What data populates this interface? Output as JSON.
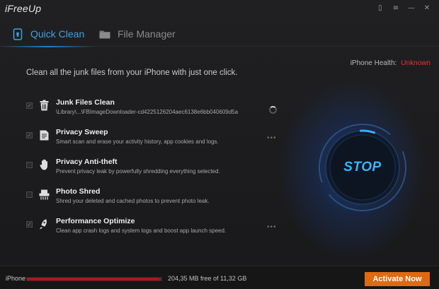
{
  "app": {
    "title": "iFreeUp"
  },
  "window_controls": [
    {
      "icon": "phone-icon",
      "glyph": "▯"
    },
    {
      "icon": "menu-icon",
      "glyph": "≡"
    },
    {
      "icon": "minimize-icon",
      "glyph": "—"
    },
    {
      "icon": "close-icon",
      "glyph": "✕"
    }
  ],
  "tabs": [
    {
      "label": "Quick Clean",
      "icon": "phone-clean-icon",
      "active": true
    },
    {
      "label": "File Manager",
      "icon": "folder-icon",
      "active": false
    }
  ],
  "health": {
    "label": "iPhone Health:",
    "value": "Unknown",
    "value_color": "#e3342f"
  },
  "intro": "Clean all the junk files from your iPhone with just one click.",
  "tasks": [
    {
      "title": "Junk Files Clean",
      "desc": "\\Library\\...\\FBImageDownloader-cd4225126204aec6138e6bb040609d5a",
      "checked": true,
      "icon": "trash-icon",
      "status": "spinner"
    },
    {
      "title": "Privacy Sweep",
      "desc": "Smart scan and erase your activity history, app cookies and logs.",
      "checked": true,
      "icon": "document-icon",
      "status": "dots"
    },
    {
      "title": "Privacy Anti-theft",
      "desc": "Prevent privacy leak by powerfully shredding everything selected.",
      "checked": false,
      "icon": "hand-icon",
      "status": ""
    },
    {
      "title": "Photo Shred",
      "desc": "Shred your deleted and cached photos to prevent photo leak.",
      "checked": false,
      "icon": "shredder-icon",
      "status": ""
    },
    {
      "title": "Performance Optimize",
      "desc": "Clean app crash logs and system logs and boost app launch speed.",
      "checked": true,
      "icon": "rocket-icon",
      "status": "dots"
    }
  ],
  "dots_glyph": "•••",
  "check_glyph": "✓",
  "action": {
    "label": "STOP",
    "progress": 0.06
  },
  "footer": {
    "device": "iPhone",
    "storage_text": "204,35 MB free of 11,32 GB",
    "storage_used_fraction": 0.982,
    "activate_label": "Activate Now"
  },
  "colors": {
    "accent": "#3fa0e0",
    "stop_text": "#34b5ff",
    "activate_bg": "#e06a10",
    "storage_fill": "#b01517"
  }
}
